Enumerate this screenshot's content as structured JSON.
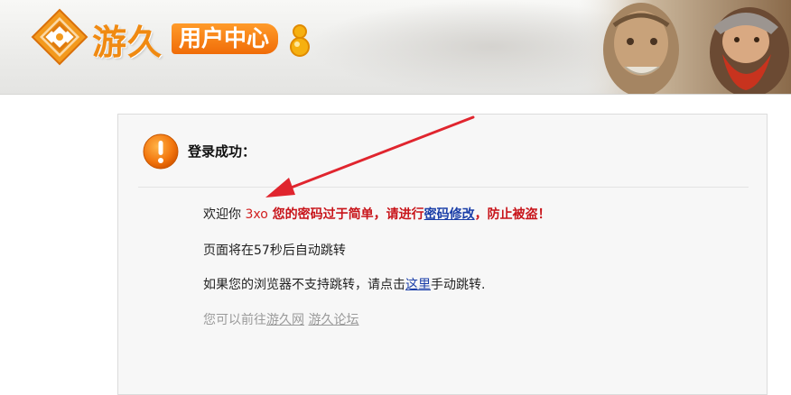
{
  "header": {
    "brand_name": "游久",
    "brand_subtitle": "用户中心"
  },
  "notice": {
    "title": "登录成功：",
    "greeting_prefix": "欢迎你 ",
    "username": "3xo",
    "warning_part1": " 您的密码过于简单，请进行",
    "change_password_link": "密码修改",
    "warning_part2": "，防止被盗！",
    "redirect_text": "页面将在57秒后自动跳转",
    "manual_prefix": "如果您的浏览器不支持跳转，请点击",
    "manual_link": "这里",
    "manual_suffix": "手动跳转.",
    "goto_prefix": "您可以前往",
    "goto_link_1": "游久网",
    "goto_link_2": "游久论坛"
  },
  "colors": {
    "brand_orange": "#f08a12",
    "warning_red": "#c8141a",
    "link_blue": "#1a3ea8",
    "annotation_arrow": "#e0252e"
  },
  "icons": {
    "logo": "youjiu-logo-icon",
    "alert": "exclamation-icon",
    "annotation": "arrow-annotation"
  }
}
